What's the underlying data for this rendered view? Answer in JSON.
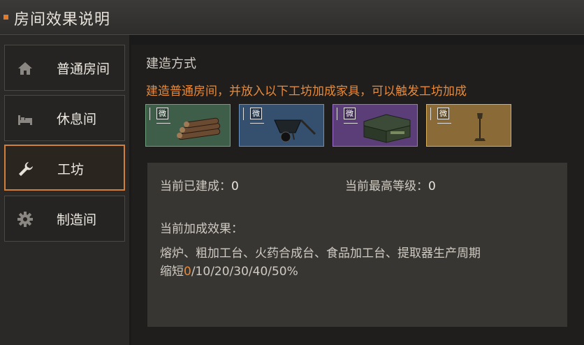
{
  "window": {
    "title": "房间效果说明"
  },
  "sidebar": {
    "items": [
      {
        "label": "普通房间",
        "icon": "home-icon",
        "active": false
      },
      {
        "label": "休息间",
        "icon": "bed-icon",
        "active": false
      },
      {
        "label": "工坊",
        "icon": "wrench-icon",
        "active": true
      },
      {
        "label": "制造间",
        "icon": "gear-icon",
        "active": false
      }
    ]
  },
  "main": {
    "section_title": "建造方式",
    "description": "建造普通房间，并放入以下工坊加成家具，可以触发工坊加成",
    "furniture": [
      {
        "badge": "微",
        "icon": "logs-icon",
        "color": "#5e8c6a"
      },
      {
        "badge": "微",
        "icon": "wheelbarrow-icon",
        "color": "#4f77a6"
      },
      {
        "badge": "微",
        "icon": "chest-icon",
        "color": "#9a64c2"
      },
      {
        "badge": "微",
        "icon": "lamp-post-icon",
        "color": "#c9a25a"
      }
    ],
    "stats": {
      "built_label": "当前已建成：",
      "built_value": "0",
      "max_level_label": "当前最高等级：",
      "max_level_value": "0"
    },
    "effect": {
      "label": "当前加成效果：",
      "text_line1": "熔炉、粗加工台、火药合成台、食品加工台、提取器生产周期",
      "text_line2_prefix": "缩短",
      "highlight": "0",
      "text_line2_suffix": "/10/20/30/40/50%"
    }
  }
}
